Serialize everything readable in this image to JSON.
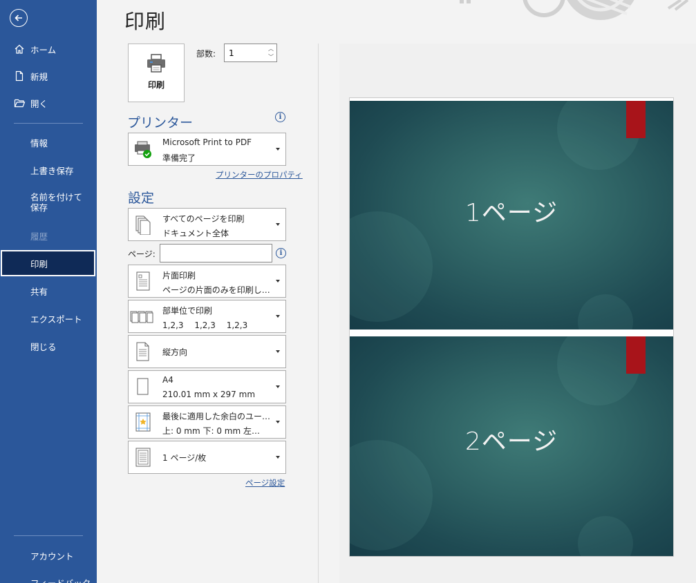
{
  "sidebar": {
    "items": [
      {
        "label": "ホーム"
      },
      {
        "label": "新規"
      },
      {
        "label": "開く"
      },
      {
        "label": "情報"
      },
      {
        "label": "上書き保存"
      },
      {
        "label": "名前を付けて保存"
      },
      {
        "label": "履歴"
      },
      {
        "label": "印刷"
      },
      {
        "label": "共有"
      },
      {
        "label": "エクスポート"
      },
      {
        "label": "閉じる"
      },
      {
        "label": "アカウント"
      },
      {
        "label": "フィードバック"
      }
    ]
  },
  "page": {
    "title": "印刷"
  },
  "print": {
    "button_label": "印刷",
    "copies_label": "部数:",
    "copies_value": "1"
  },
  "printer": {
    "heading": "プリンター",
    "name": "Microsoft Print to PDF",
    "status": "準備完了",
    "properties_link": "プリンターのプロパティ"
  },
  "settings": {
    "heading": "設定",
    "pages_label": "ページ:",
    "pages_value": "",
    "options": [
      {
        "line1": "すべてのページを印刷",
        "line2": "ドキュメント全体"
      },
      {
        "line1": "片面印刷",
        "line2": "ページの片面のみを印刷し…"
      },
      {
        "line1": "部単位で印刷",
        "line2": "1,2,3　 1,2,3　 1,2,3"
      },
      {
        "line1": "縦方向",
        "line2": ""
      },
      {
        "line1": "A4",
        "line2": "210.01 mm x 297 mm"
      },
      {
        "line1": "最後に適用した余白のユー…",
        "line2": "上: 0 mm 下: 0 mm 左…"
      },
      {
        "line1": "1 ページ/枚",
        "line2": ""
      }
    ],
    "page_setup_link": "ページ設定"
  },
  "preview": {
    "slides": [
      {
        "title": "1ページ"
      },
      {
        "title": "2ページ"
      }
    ],
    "accent_color": "#a8141a",
    "slide_color": "#2e6264"
  },
  "colors": {
    "sidebar": "#2b579a",
    "selected": "#0f2a57"
  }
}
